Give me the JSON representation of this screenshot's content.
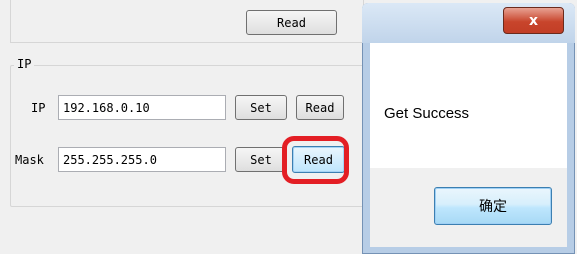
{
  "top_panel": {
    "read_label": "Read"
  },
  "ip_group": {
    "title": "IP",
    "ip_row": {
      "label": "IP",
      "value": "192.168.0.10",
      "set_label": "Set",
      "read_label": "Read"
    },
    "mask_row": {
      "label": "Mask",
      "value": "255.255.255.0",
      "set_label": "Set",
      "read_label": "Read"
    }
  },
  "dialog": {
    "close_symbol": "x",
    "message": "Get Success",
    "ok_label": "确定"
  }
}
